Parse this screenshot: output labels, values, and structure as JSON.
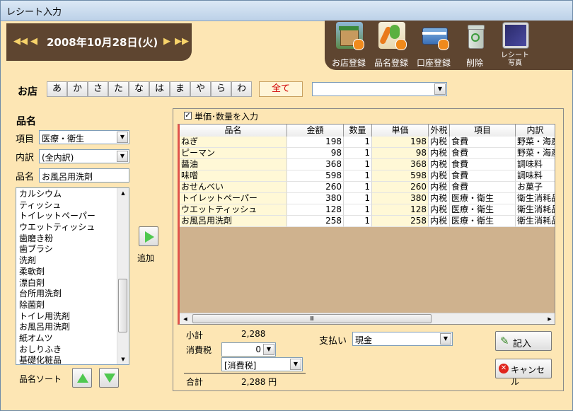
{
  "window": {
    "title": "レシート入力"
  },
  "date": {
    "text": "2008年10月28日(火)",
    "first": "◀◀",
    "prev": "◀",
    "next": "▶",
    "last": "▶▶"
  },
  "toolbar": [
    {
      "label": "お店登録",
      "icon": "shop-icon"
    },
    {
      "label": "品名登録",
      "icon": "vegetables-icon"
    },
    {
      "label": "口座登録",
      "icon": "bank-card-icon"
    },
    {
      "label": "削除",
      "icon": "recycle-bin-icon"
    },
    {
      "label": "レシート\n写真",
      "icon": "receipt-photo-icon"
    }
  ],
  "shop": {
    "label": "お店",
    "kana": [
      "あ",
      "か",
      "さ",
      "た",
      "な",
      "は",
      "ま",
      "や",
      "ら",
      "わ",
      "全て"
    ],
    "selected_kana": "全て",
    "selected": ""
  },
  "item_panel": {
    "title": "品名",
    "category_label": "項目",
    "category_value": "医療・衛生",
    "detail_label": "内訳",
    "detail_value": "(全内訳)",
    "name_label": "品名",
    "name_value": "お風呂用洗剤",
    "list": [
      "カルシウム",
      "ティッシュ",
      "トイレットペーパー",
      "ウエットティッシュ",
      "歯磨き粉",
      "歯ブラシ",
      "洗剤",
      "柔軟剤",
      "漂白剤",
      "台所用洗剤",
      "除菌剤",
      "トイレ用洗剤",
      "お風呂用洗剤",
      "紙オムツ",
      "おしりふき",
      "基礎化粧品"
    ],
    "add_label": "追加",
    "sort_label": "品名ソート"
  },
  "receipt": {
    "unit_qty_checkbox": {
      "label": "単価･数量を入力",
      "checked": true,
      "mark": "✓"
    },
    "columns": [
      "品名",
      "金額",
      "数量",
      "単価",
      "外税",
      "項目",
      "内訳"
    ],
    "rows": [
      [
        "ねぎ",
        "198",
        "1",
        "198",
        "内税",
        "食費",
        "野菜・海産"
      ],
      [
        "ピーマン",
        "98",
        "1",
        "98",
        "内税",
        "食費",
        "野菜・海産"
      ],
      [
        "醤油",
        "368",
        "1",
        "368",
        "内税",
        "食費",
        "調味料"
      ],
      [
        "味噌",
        "598",
        "1",
        "598",
        "内税",
        "食費",
        "調味料"
      ],
      [
        "おせんべい",
        "260",
        "1",
        "260",
        "内税",
        "食費",
        "お菓子"
      ],
      [
        "トイレットペーパー",
        "380",
        "1",
        "380",
        "内税",
        "医療・衛生",
        "衛生消耗品"
      ],
      [
        "ウエットティッシュ",
        "128",
        "1",
        "128",
        "内税",
        "医療・衛生",
        "衛生消耗品"
      ],
      [
        "お風呂用洗剤",
        "258",
        "1",
        "258",
        "内税",
        "医療・衛生",
        "衛生消耗品"
      ]
    ],
    "subtotal_label": "小計",
    "subtotal_value": "2,288",
    "tax_label": "消費税",
    "tax_value": "0",
    "tax_type": "[消費税]",
    "total_label": "合計",
    "total_value": "2,288 円",
    "payment_label": "支払い",
    "payment_value": "現金"
  },
  "actions": {
    "submit": "記入",
    "cancel": "キャンセル"
  }
}
